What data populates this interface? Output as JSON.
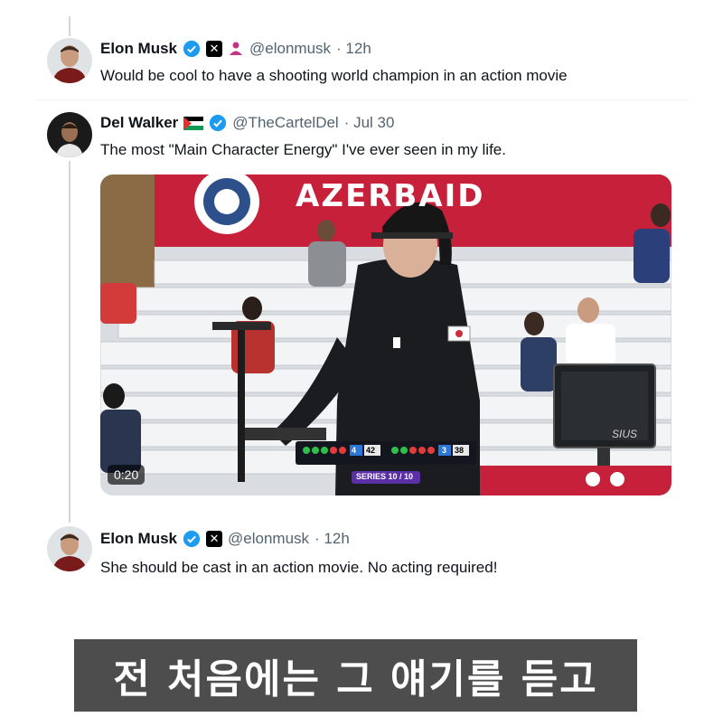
{
  "tweets": [
    {
      "name": "Elon Musk",
      "handle": "@elonmusk",
      "time": "· 12h",
      "text": "Would be cool to have a shooting world champion in an action movie"
    },
    {
      "name": "Del Walker",
      "handle": "@TheCartelDel",
      "time": "· Jul 30",
      "text": "The most \"Main Character Energy\" I've ever seen in my life."
    },
    {
      "name": "Elon Musk",
      "handle": "@elonmusk",
      "time": "· 12h",
      "text": "She should be cast in an action movie. No  acting required!"
    }
  ],
  "video": {
    "duration": "0:20",
    "banner_text": "AZERBAID",
    "scoreboard": {
      "left_score_a": "4",
      "left_score_b": "42",
      "right_score_a": "3",
      "right_score_b": "38",
      "series": "SERIES 10 / 10"
    },
    "monitor_brand": "SIUS"
  },
  "caption": "전 처음에는 그 얘기를 듣고",
  "colors": {
    "verified_blue": "#1d9bf0",
    "handle_gray": "#536471",
    "banner_red": "#c7203a"
  },
  "icons": {
    "verified": "verified-badge-icon",
    "x_badge": "x-logo-icon",
    "affiliate": "affiliate-person-icon",
    "flag": "palestine-flag-icon"
  }
}
